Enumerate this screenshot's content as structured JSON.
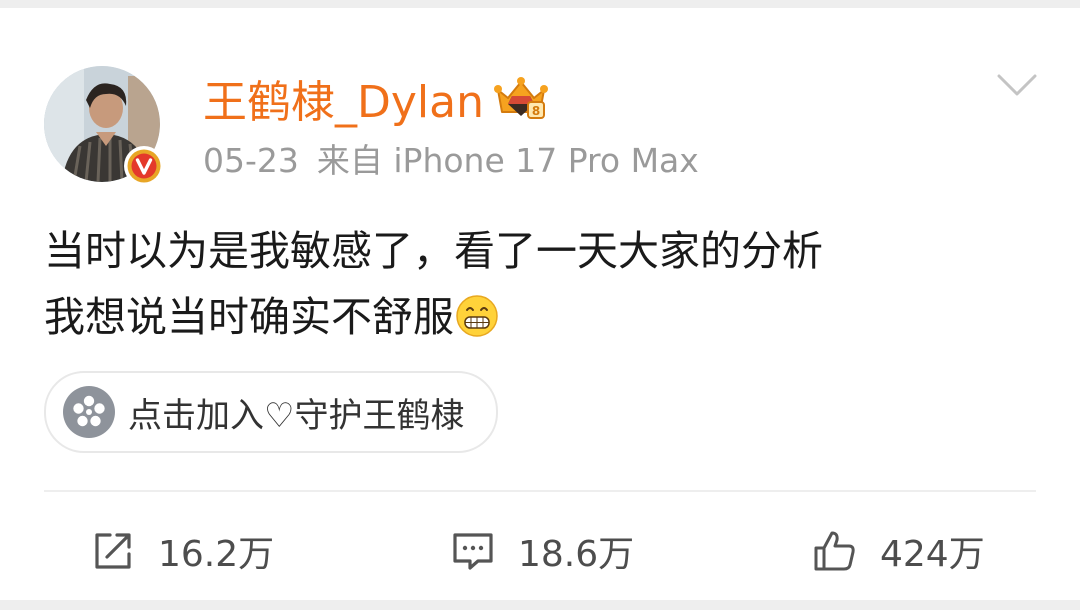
{
  "user": {
    "name": "王鹤棣_Dylan",
    "avatar_icon": "profile-photo",
    "verified_icon": "v-verified-badge",
    "crown_icon": "vip-crown-badge",
    "name_color": "#f0701a"
  },
  "meta": {
    "date": "05-23",
    "source": "来自 iPhone 17 Pro Max"
  },
  "post": {
    "line1": "当时以为是我敏感了，看了一天大家的分析",
    "line2": "我想说当时确实不舒服",
    "emoji_icon": "grin-emoji"
  },
  "supertopic": {
    "label": "点击加入♡守护王鹤棣",
    "icon": "supertopic-flower-icon"
  },
  "actions": {
    "repost": {
      "count": "16.2万",
      "icon": "share-icon"
    },
    "comment": {
      "count": "18.6万",
      "icon": "comment-icon"
    },
    "like": {
      "count": "424万",
      "icon": "thumbs-up-icon"
    }
  }
}
